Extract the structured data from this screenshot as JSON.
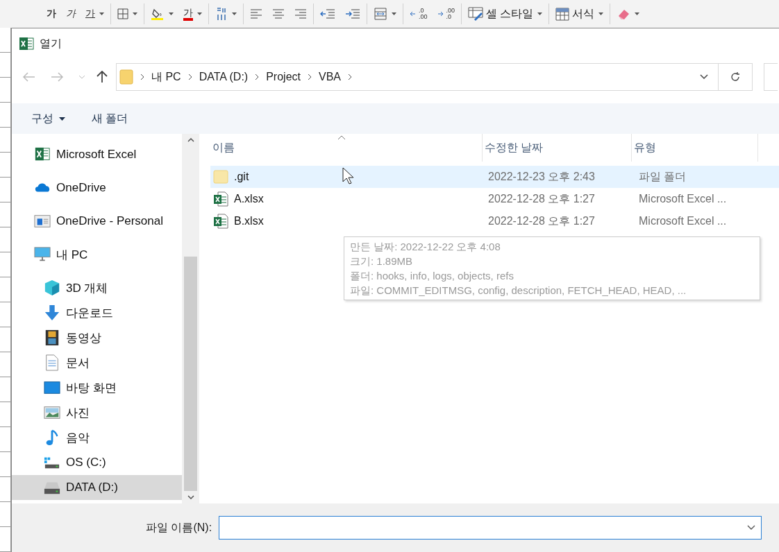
{
  "ribbon": {
    "items": [
      {
        "kind": "bold",
        "label": "가",
        "dropdown": false
      },
      {
        "kind": "italic",
        "label": "가",
        "dropdown": false
      },
      {
        "kind": "underline",
        "label": "가",
        "dropdown": true
      },
      {
        "kind": "borders",
        "dropdown": true
      },
      {
        "kind": "fill",
        "dropdown": true
      },
      {
        "kind": "fontcolor",
        "label": "가",
        "dropdown": true
      },
      {
        "kind": "textdir",
        "dropdown": true
      },
      {
        "kind": "align-left",
        "dropdown": false
      },
      {
        "kind": "align-center",
        "dropdown": false
      },
      {
        "kind": "align-right",
        "dropdown": false
      },
      {
        "kind": "outdent",
        "dropdown": false
      },
      {
        "kind": "indent",
        "dropdown": false
      },
      {
        "kind": "merge",
        "dropdown": true
      },
      {
        "kind": "decimal-add",
        "lines": [
          ".0",
          ".00"
        ],
        "dropdown": false
      },
      {
        "kind": "decimal-remove",
        "lines": [
          ".00",
          ".0"
        ],
        "dropdown": false
      },
      {
        "kind": "cell-style",
        "label": "셀 스타일",
        "dropdown": true
      },
      {
        "kind": "format",
        "label": "서식",
        "dropdown": true
      },
      {
        "kind": "eraser",
        "dropdown": true
      }
    ]
  },
  "window": {
    "title": "열기"
  },
  "address": {
    "crumbs": [
      "내 PC",
      "DATA (D:)",
      "Project",
      "VBA"
    ]
  },
  "toolbar": {
    "organize": "구성",
    "new_folder": "새 폴더"
  },
  "sidebar": {
    "items": [
      {
        "label": "Microsoft Excel",
        "selected": false
      },
      {
        "label": "OneDrive",
        "selected": false
      },
      {
        "label": "OneDrive - Personal",
        "selected": false
      },
      {
        "label": "내 PC",
        "selected": false,
        "children": [
          {
            "label": "3D 개체",
            "selected": false
          },
          {
            "label": "다운로드",
            "selected": false
          },
          {
            "label": "동영상",
            "selected": false
          },
          {
            "label": "문서",
            "selected": false
          },
          {
            "label": "바탕 화면",
            "selected": false
          },
          {
            "label": "사진",
            "selected": false
          },
          {
            "label": "음악",
            "selected": false
          },
          {
            "label": "OS (C:)",
            "selected": false
          },
          {
            "label": "DATA (D:)",
            "selected": true
          }
        ]
      }
    ]
  },
  "files": {
    "columns": [
      "이름",
      "수정한 날짜",
      "유형"
    ],
    "rows": [
      {
        "kind": "folder",
        "name": ".git",
        "date": "2022-12-23 오후 2:43",
        "type": "파일 폴더",
        "hovered": true
      },
      {
        "kind": "excel",
        "name": "A.xlsx",
        "date": "2022-12-28 오후 1:27",
        "type": "Microsoft Excel ...",
        "hovered": false
      },
      {
        "kind": "excel",
        "name": "B.xlsx",
        "date": "2022-12-28 오후 1:27",
        "type": "Microsoft Excel ...",
        "hovered": false
      }
    ],
    "tooltip": [
      "만든 날짜: 2022-12-22 오후 4:08",
      "크기: 1.89MB",
      "폴더: hooks, info, logs, objects, refs",
      "파일: COMMIT_EDITMSG, config, description, FETCH_HEAD, HEAD, ..."
    ]
  },
  "footer": {
    "filename_label": "파일 이름(N):"
  }
}
